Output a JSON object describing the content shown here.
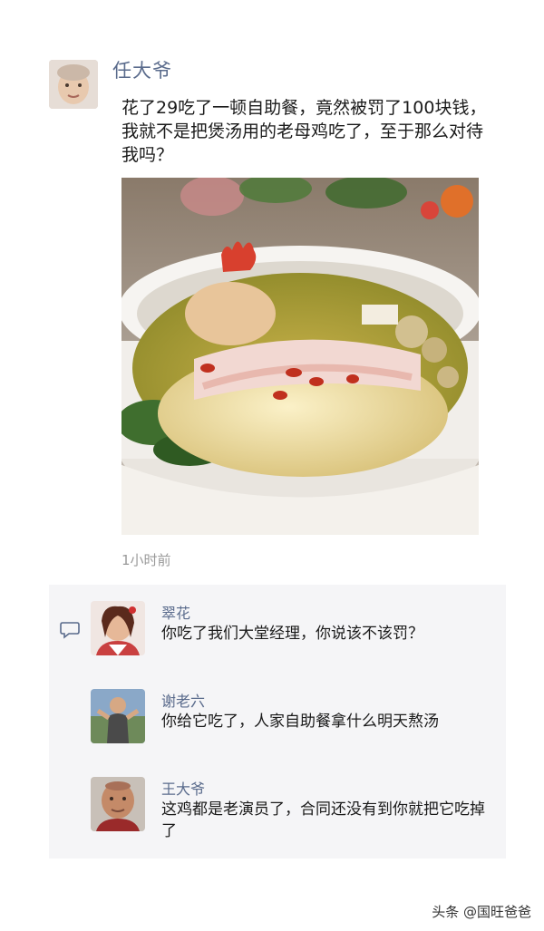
{
  "post": {
    "author": "任大爷",
    "text": "花了29吃了一顿自助餐，竟然被罚了100块钱，我就不是把煲汤用的老母鸡吃了，至于那么对待我吗？",
    "time": "1小时前"
  },
  "comments": [
    {
      "name": "翠花",
      "text": "你吃了我们大堂经理，你说该不该罚？"
    },
    {
      "name": "谢老六",
      "text": "你给它吃了，人家自助餐拿什么明天熬汤"
    },
    {
      "name": "王大爷",
      "text": "这鸡都是老演员了，合同还没有到你就把它吃掉了"
    }
  ],
  "watermark": "头条 @国旺爸爸",
  "colors": {
    "name": "#5a6b8c",
    "time": "#9a9a9a",
    "panel_bg": "#f5f5f7"
  }
}
